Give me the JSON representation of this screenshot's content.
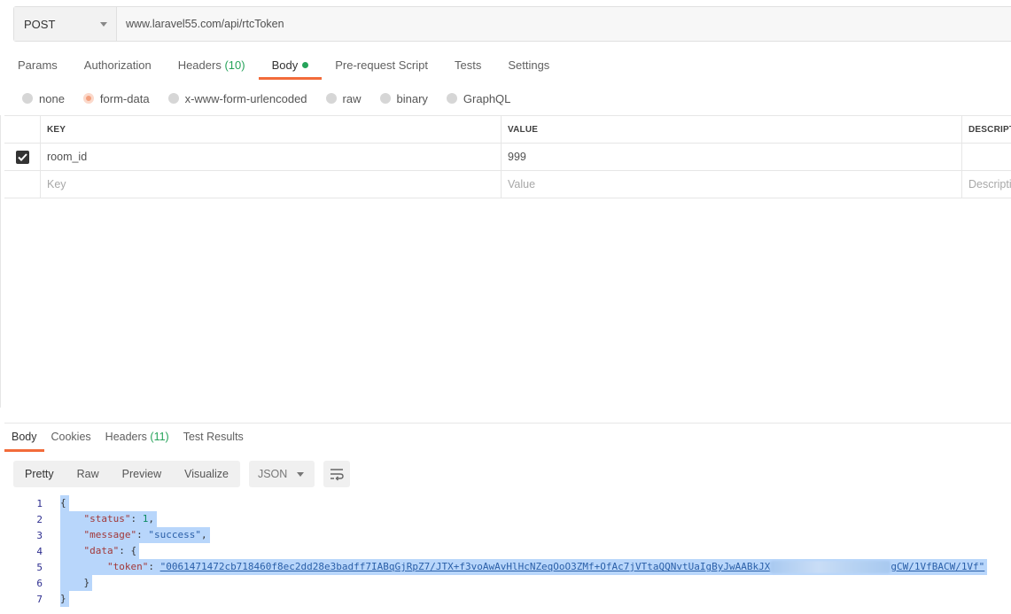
{
  "request": {
    "method": "POST",
    "url": "www.laravel55.com/api/rtcToken"
  },
  "request_tabs": [
    {
      "label": "Params",
      "count": ""
    },
    {
      "label": "Authorization",
      "count": ""
    },
    {
      "label": "Headers",
      "count": "(10)"
    },
    {
      "label": "Body",
      "count": ""
    },
    {
      "label": "Pre-request Script",
      "count": ""
    },
    {
      "label": "Tests",
      "count": ""
    },
    {
      "label": "Settings",
      "count": ""
    }
  ],
  "body_types": [
    "none",
    "form-data",
    "x-www-form-urlencoded",
    "raw",
    "binary",
    "GraphQL"
  ],
  "params_table": {
    "headers": [
      "KEY",
      "VALUE",
      "DESCRIPTI"
    ],
    "rows": [
      {
        "key": "room_id",
        "value": "999",
        "description": ""
      }
    ],
    "placeholders": {
      "key": "Key",
      "value": "Value",
      "description": "Descripti"
    }
  },
  "response_tabs": [
    {
      "label": "Body",
      "count": ""
    },
    {
      "label": "Cookies",
      "count": ""
    },
    {
      "label": "Headers",
      "count": "(11)"
    },
    {
      "label": "Test Results",
      "count": ""
    }
  ],
  "view_modes": [
    "Pretty",
    "Raw",
    "Preview",
    "Visualize"
  ],
  "format": "JSON",
  "code_lines": {
    "n": [
      "1",
      "2",
      "3",
      "4",
      "5",
      "6",
      "7"
    ],
    "open": "{",
    "status_key": "\"status\"",
    "status_val": "1",
    "message_key": "\"message\"",
    "message_val": "\"success\"",
    "data_key": "\"data\"",
    "token_key": "\"token\"",
    "token_start": "\"0061471472cb718460f8ec2dd28e3badff7IABqGjRpZ7/JTX+f3voAwAvHlHcNZeqOoO3ZMf+OfAc7jVTtaQQNvtUaIgByJwAABkJX",
    "token_end": "gCW/1VfBACW/1Vf\"",
    "close_inner": "}",
    "close": "}"
  },
  "colors": {
    "accent": "#f26b3a",
    "count": "#26a35a",
    "selection": "#b8d6fb"
  }
}
